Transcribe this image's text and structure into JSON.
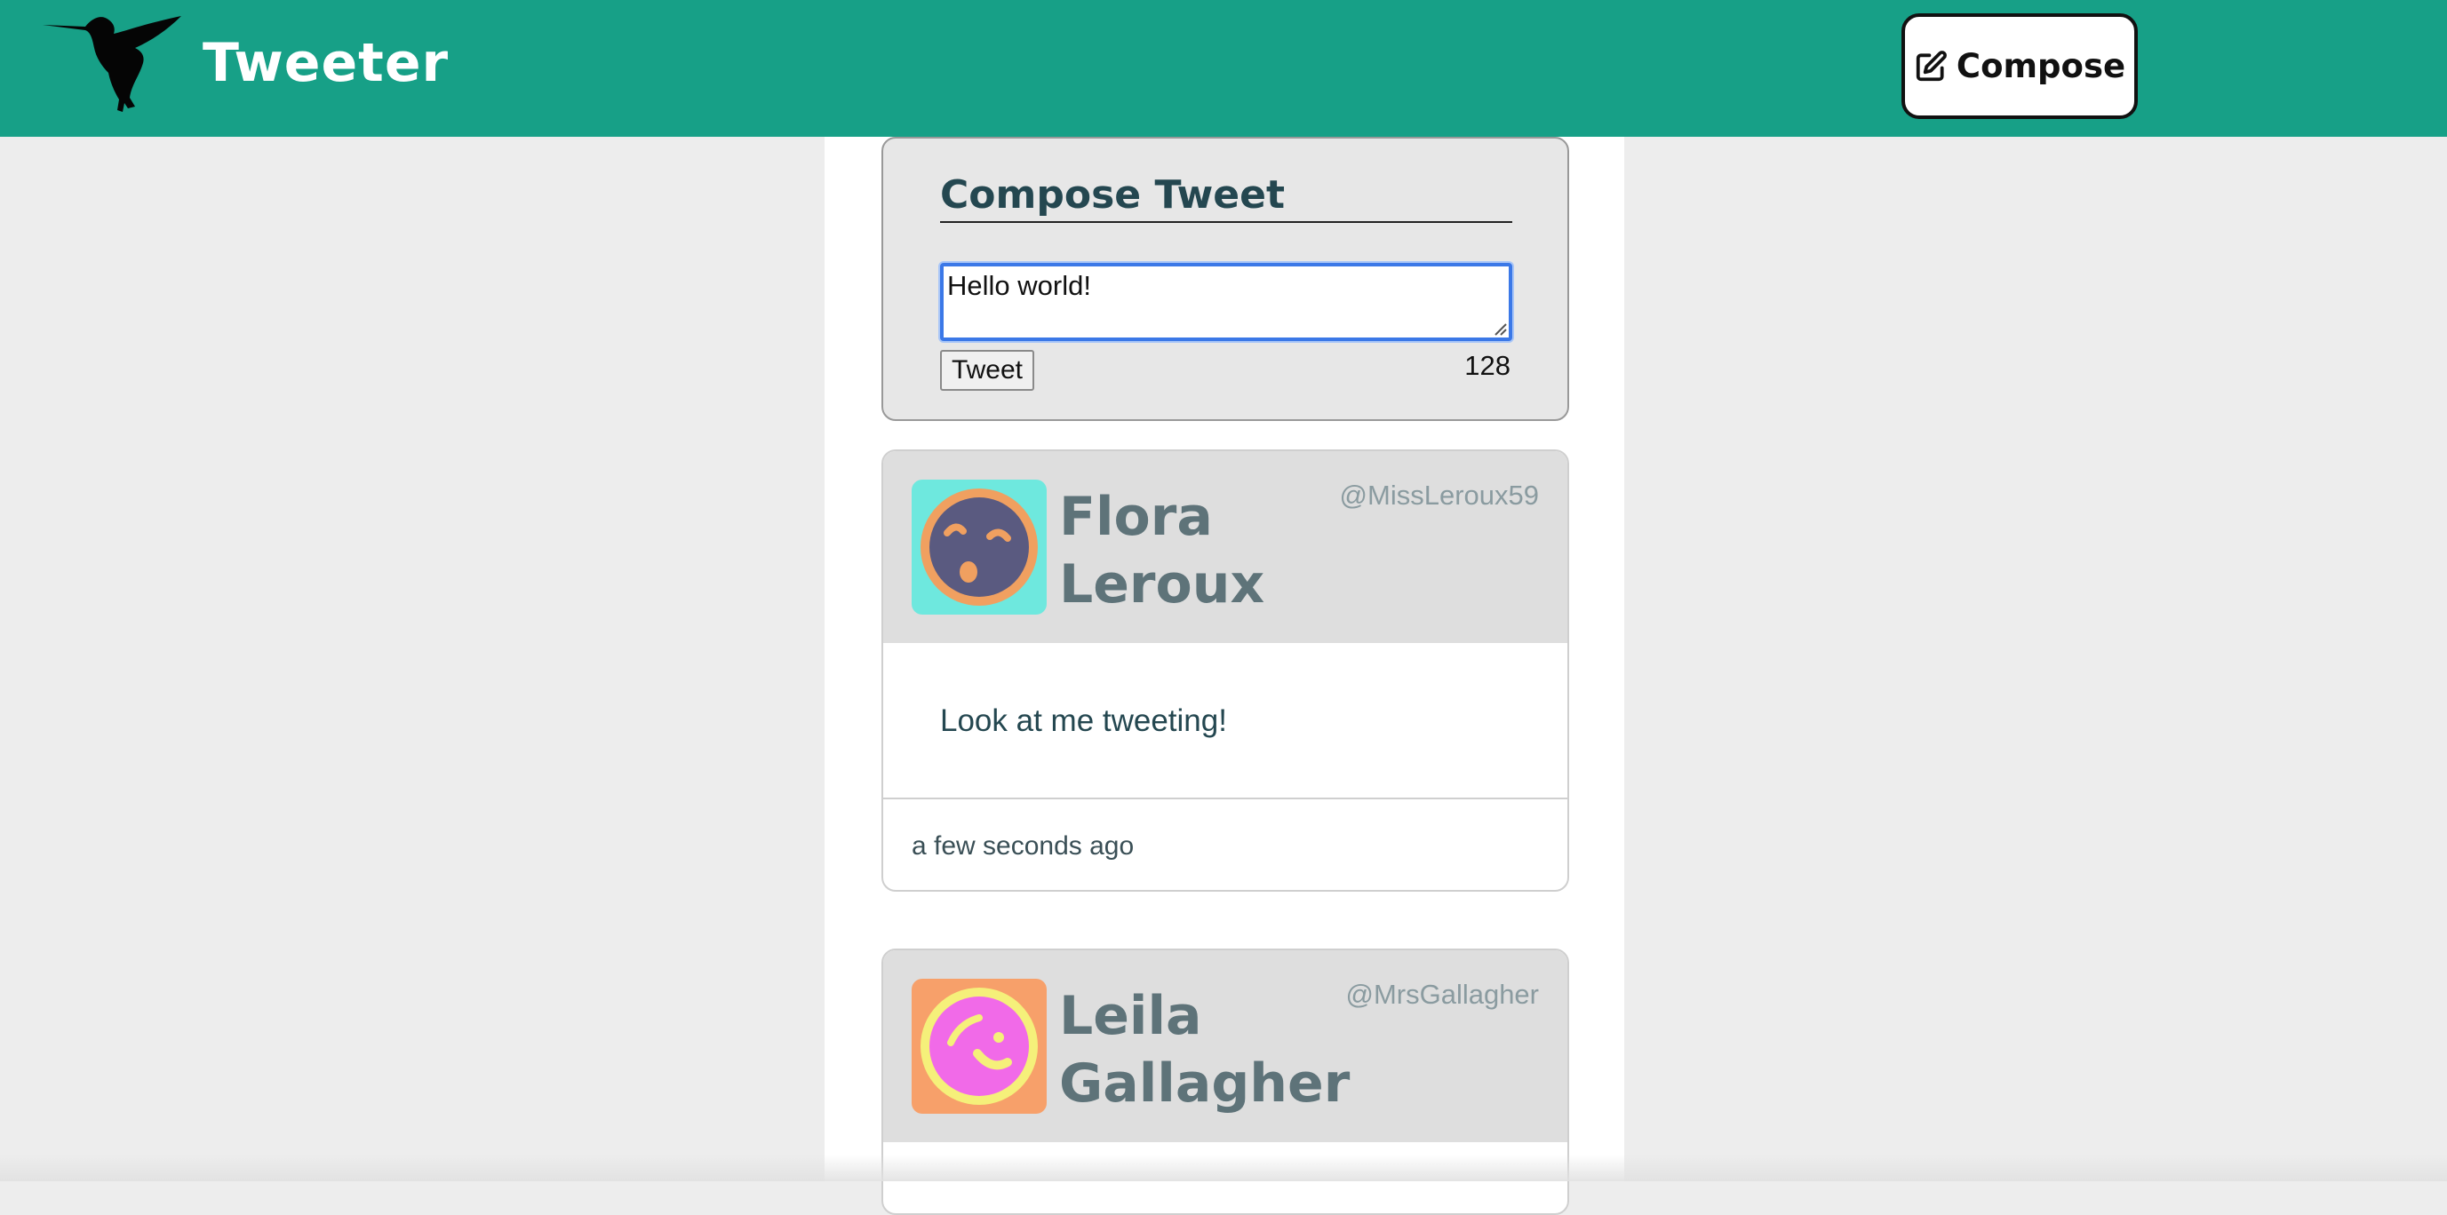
{
  "navbar": {
    "brand": "Tweeter",
    "compose_label": "Compose",
    "bg_color": "#17a087"
  },
  "compose": {
    "title": "Compose Tweet",
    "input_value": "Hello world!",
    "tweet_button_label": "Tweet",
    "char_counter": "128",
    "focus_color": "#3b78e7"
  },
  "tweets": [
    {
      "name": "Flora Leroux",
      "handle": "@MissLeroux59",
      "text": "Look at me tweeting!",
      "time": "a few seconds ago",
      "avatar_icon": "avatar-icon",
      "avatar_bg": "#6ee8de",
      "avatar_ring": "#f0a060",
      "avatar_face": "#5a5a80"
    },
    {
      "name": "Leila Gallagher",
      "handle": "@MrsGallagher",
      "avatar_icon": "avatar-icon",
      "avatar_bg": "#f7a06a",
      "avatar_ring": "#f5f07a",
      "avatar_face": "#f16ae8"
    }
  ]
}
